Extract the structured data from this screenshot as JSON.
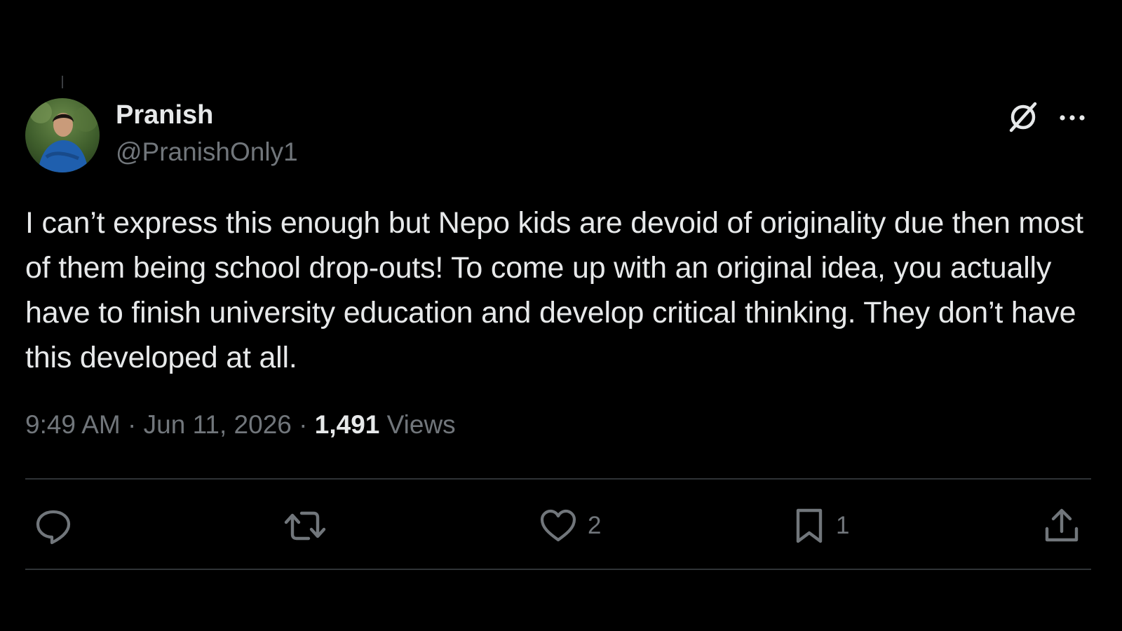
{
  "post": {
    "author": {
      "display_name": "Pranish",
      "handle": "@PranishOnly1"
    },
    "text": "I can’t express this enough but Nepo kids are devoid of originality due then most of them being school drop-outs! To come up with an original idea, you actually have to finish university education and develop critical thinking. They don’t have this developed at all.",
    "time": "9:49 AM",
    "separator": " · ",
    "date": "Jun 11, 2026",
    "views_count": "1,491",
    "views_label": "Views"
  },
  "actions": {
    "reply": {
      "icon": "reply-icon",
      "count": ""
    },
    "repost": {
      "icon": "repost-icon",
      "count": ""
    },
    "like": {
      "icon": "heart-icon",
      "count": "2"
    },
    "bookmark": {
      "icon": "bookmark-icon",
      "count": "1"
    },
    "share": {
      "icon": "share-icon",
      "count": ""
    }
  },
  "colors": {
    "background": "#000000",
    "text_primary": "#e7e9ea",
    "text_secondary": "#71767b",
    "divider": "#2f3336"
  }
}
